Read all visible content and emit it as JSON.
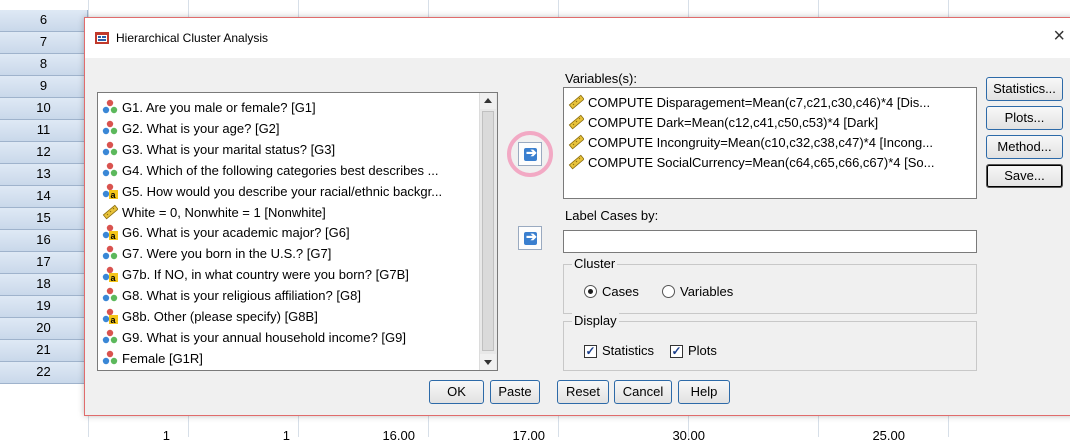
{
  "spreadsheet": {
    "row_numbers": [
      "6",
      "7",
      "8",
      "9",
      "10",
      "11",
      "12",
      "13",
      "14",
      "15",
      "16",
      "17",
      "18",
      "19",
      "20",
      "21",
      "22"
    ],
    "bottom_row_values": [
      "1",
      "1",
      "16.00",
      "17.00",
      "30.00",
      "25.00"
    ]
  },
  "dialog": {
    "title": "Hierarchical Cluster Analysis",
    "close_glyph": "×",
    "source_variables": [
      {
        "label": "G1. Are you male or female? [G1]",
        "icon": "nominal-icon"
      },
      {
        "label": "G2. What is your age? [G2]",
        "icon": "nominal-icon"
      },
      {
        "label": "G3. What is your marital status? [G3]",
        "icon": "nominal-icon"
      },
      {
        "label": "G4. Which of the following categories best describes ...",
        "icon": "nominal-icon"
      },
      {
        "label": "G5. How would you describe your racial/ethnic backgr...",
        "icon": "string-nominal-icon"
      },
      {
        "label": "White = 0, Nonwhite = 1 [Nonwhite]",
        "icon": "scale-ruler-icon"
      },
      {
        "label": "G6. What is your academic major? [G6]",
        "icon": "string-nominal-icon"
      },
      {
        "label": "G7. Were you born in the U.S.? [G7]",
        "icon": "nominal-icon"
      },
      {
        "label": "G7b. If NO, in what country were you born? [G7B]",
        "icon": "string-nominal-icon"
      },
      {
        "label": "G8. What is your religious affiliation? [G8]",
        "icon": "nominal-icon"
      },
      {
        "label": "G8b. Other (please specify) [G8B]",
        "icon": "string-nominal-icon"
      },
      {
        "label": "G9. What is your annual household income? [G9]",
        "icon": "nominal-icon"
      },
      {
        "label": "Female  [G1R]",
        "icon": "nominal-icon"
      }
    ],
    "variables_label": "Variables(s):",
    "selected_variables": [
      "COMPUTE Disparagement=Mean(c7,c21,c30,c46)*4 [Dis...",
      "COMPUTE Dark=Mean(c12,c41,c50,c53)*4 [Dark]",
      "COMPUTE Incongruity=Mean(c10,c32,c38,c47)*4 [Incong...",
      "COMPUTE SocialCurrency=Mean(c64,c65,c66,c67)*4 [So..."
    ],
    "label_cases_label": "Label Cases by:",
    "label_cases_value": "",
    "cluster_group": {
      "title": "Cluster",
      "option_cases": "Cases",
      "option_variables": "Variables",
      "selected": "Cases"
    },
    "display_group": {
      "title": "Display",
      "statistics_label": "Statistics",
      "plots_label": "Plots",
      "statistics_checked": true,
      "plots_checked": true
    },
    "side_buttons": [
      "Statistics...",
      "Plots...",
      "Method...",
      "Save..."
    ],
    "bottom_buttons": [
      "OK",
      "Paste",
      "Reset",
      "Cancel",
      "Help"
    ]
  }
}
